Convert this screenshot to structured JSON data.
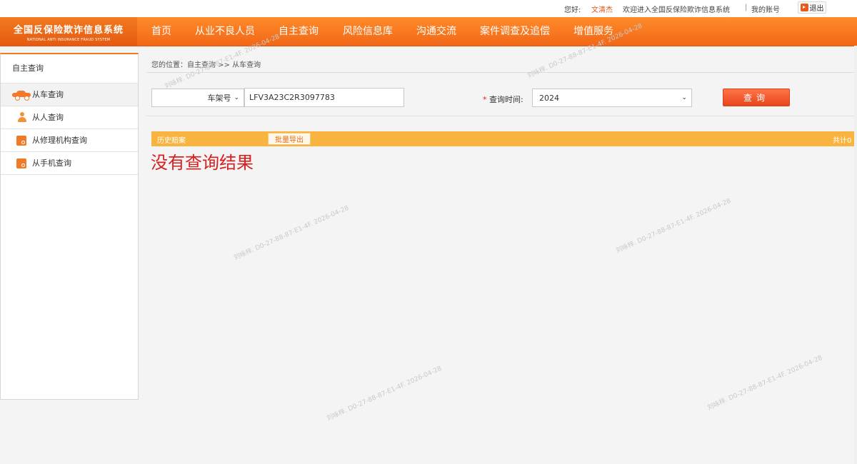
{
  "topbar": {
    "greeting": "您好:",
    "username": "文清杰",
    "welcome": "欢迎进入全国反保险欺诈信息系统",
    "separator": "|",
    "my_account": "我的账号",
    "logout": "退出"
  },
  "brand": {
    "name_cn": "全国反保险欺诈信息系统",
    "name_en": "NATIONAL ANTI INSURANCE FRAUD SYSTEM"
  },
  "nav": {
    "items": [
      "首页",
      "从业不良人员",
      "自主查询",
      "风险信息库",
      "沟通交流",
      "案件调查及追偿",
      "增值服务"
    ]
  },
  "sidebar": {
    "title": "自主查询",
    "items": [
      {
        "label": "从车查询",
        "icon": "car-icon"
      },
      {
        "label": "从人查询",
        "icon": "person-icon"
      },
      {
        "label": "从修理机构查询",
        "icon": "repair-shop-icon"
      },
      {
        "label": "从手机查询",
        "icon": "phone-icon"
      }
    ]
  },
  "breadcrumb": "您的位置：自主查询 >> 从车查询",
  "search": {
    "type_selected": "车架号",
    "vin_value": "LFV3A23C2R3097783",
    "time_label_required": "*",
    "time_label": "查询时间:",
    "time_selected": "2024",
    "query_button": "查询"
  },
  "results": {
    "history_label": "历史赔案",
    "export_button": "批量导出",
    "total_label": "共计0",
    "no_result_text": "没有查询结果"
  },
  "watermark": "刘咏梓. D0-27-88-87-E1-4F. 2026-04-28",
  "colors": {
    "brand_orange": "#f27a1f",
    "query_button": "#f0552a",
    "history_bar": "#f8b43f",
    "no_result": "#d62020"
  }
}
